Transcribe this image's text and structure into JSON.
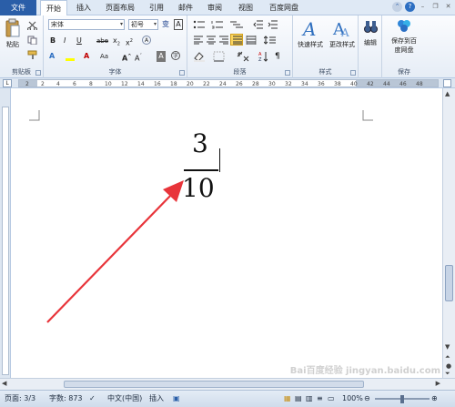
{
  "tabs": {
    "file": "文件",
    "items": [
      "开始",
      "插入",
      "页面布局",
      "引用",
      "邮件",
      "审阅",
      "视图",
      "百度网盘"
    ]
  },
  "ribbon": {
    "clipboard": {
      "paste": "粘贴",
      "label": "剪贴板"
    },
    "font": {
      "name": "宋体",
      "size": "初号",
      "label": "字体"
    },
    "paragraph": {
      "label": "段落"
    },
    "styles": {
      "quick_styles": "快速样式",
      "change_styles": "更改样式",
      "label": "样式"
    },
    "editing": {
      "label": "编辑"
    },
    "save": {
      "save_to_baidu_line1": "保存到百",
      "save_to_baidu_line2": "度网盘",
      "label": "保存"
    }
  },
  "ruler": {
    "numbers": [
      "2",
      "2",
      "4",
      "6",
      "8",
      "10",
      "12",
      "14",
      "16",
      "18",
      "20",
      "22",
      "24",
      "26",
      "28",
      "30",
      "32",
      "34",
      "36",
      "38",
      "40",
      "42",
      "44",
      "46",
      "48"
    ]
  },
  "document": {
    "numerator": "3",
    "denominator": "10"
  },
  "status": {
    "page": "页面: 3/3",
    "words": "字数: 873",
    "language": "中文(中国)",
    "mode": "插入",
    "zoom": "100%"
  },
  "watermark": "Bai百度经验 jingyan.baidu.com",
  "colors": {
    "accent": "#2a5ea8",
    "arrow": "#e8343a"
  }
}
